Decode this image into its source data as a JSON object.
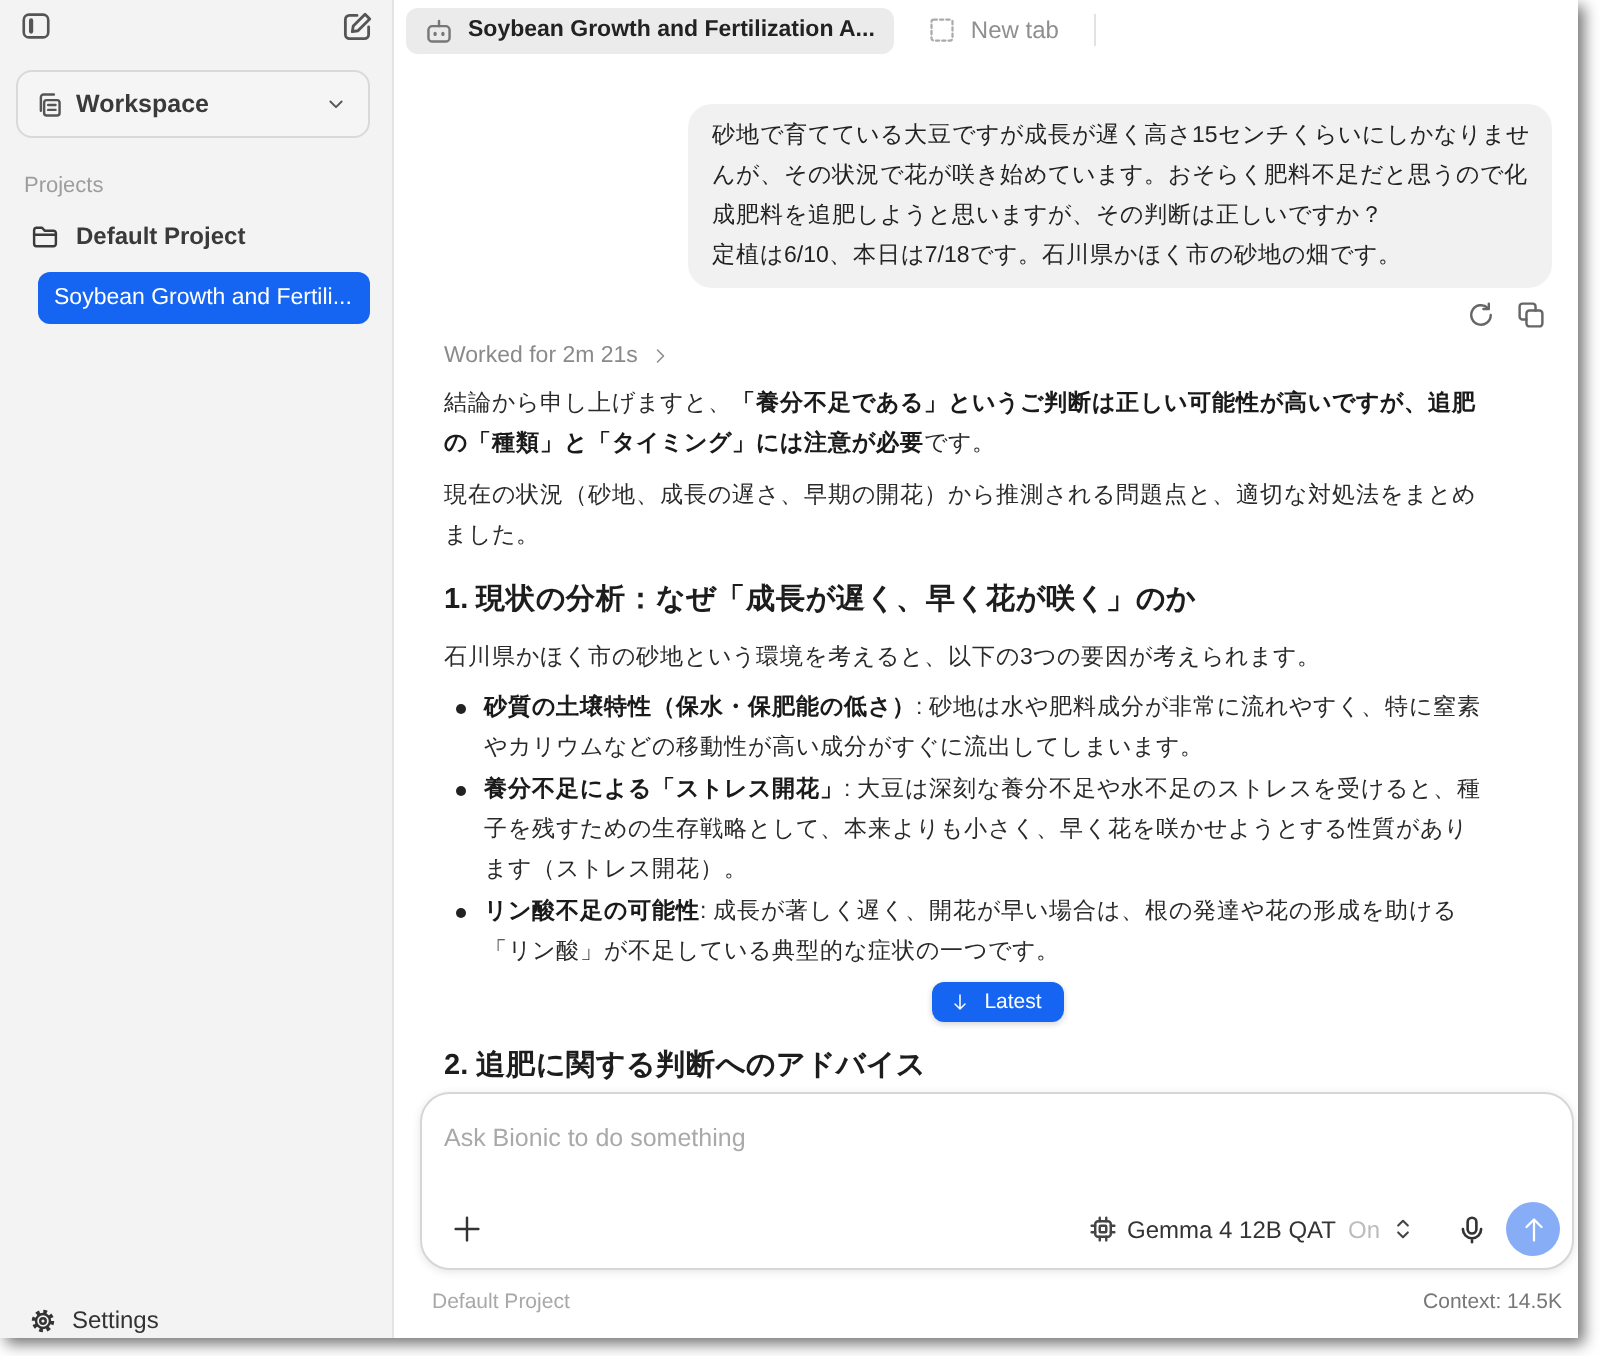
{
  "sidebar": {
    "workspace": {
      "label": "Workspace"
    },
    "projects_heading": "Projects",
    "projects": [
      {
        "label": "Default Project",
        "children": [
          {
            "label": "Soybean Growth and Fertili...",
            "selected": true
          }
        ]
      }
    ],
    "settings": {
      "label": "Settings"
    }
  },
  "tabs": [
    {
      "kind": "chat",
      "label": "Soybean Growth and Fertilization A...",
      "selected": true
    },
    {
      "kind": "new",
      "label": "New tab",
      "selected": false
    }
  ],
  "conversation": {
    "user_message": {
      "paragraphs": [
        "砂地で育てている大豆ですが成長が遅く高さ15センチくらいにしかなりませんが、その状況で花が咲き始めています。おそらく肥料不足だと思うので化成肥料を追肥しようと思いますが、その判断は正しいですか？",
        "定植は6/10、本日は7/18です。石川県かほく市の砂地の畑です。"
      ]
    },
    "assistant_message": {
      "worked": {
        "label": "Worked for 2m 21s",
        "expanded": false
      },
      "blocks": [
        {
          "kind": "paragraph",
          "text": "結論から申し上げますと、**「養分不足である」というご判断は正しい可能性が高いですが、追肥の「種類」と「タイミング」には注意が必要**です。"
        },
        {
          "kind": "paragraph",
          "text": "現在の状況（砂地、成長の遅さ、早期の開花）から推測される問題点と、適切な対処法をまとめました。"
        },
        {
          "kind": "heading",
          "text": "1. 現状の分析：なぜ「成長が遅く、早く花が咲く」のか"
        },
        {
          "kind": "paragraph",
          "text": "石川県かほく市の砂地という環境を考えると、以下の3つの要因が考えられます。"
        },
        {
          "kind": "list",
          "items": [
            "**砂質の土壌特性（保水・保肥能の低さ）**: 砂地は水や肥料成分が非常に流れやすく、特に窒素やカリウムなどの移動性が高い成分がすぐに流出してしまいます。",
            "**養分不足による「ストレス開花」**: 大豆は深刻な養分不足や水不足のストレスを受けると、種子を残すための生存戦略として、本来よりも小さく、早く花を咲かせようとする性質があります（ストレス開花）。",
            "**リン酸不足の可能性**: 成長が著しく遅く、開花が早い場合は、根の発達や花の形成を助ける「リン酸」が不足している典型的な症状の一つです。"
          ]
        },
        {
          "kind": "jump_button",
          "label": "Latest"
        },
        {
          "kind": "heading",
          "text": "2. 追肥に関する判断へのアドバイス"
        }
      ]
    }
  },
  "composer": {
    "placeholder": "Ask Bionic to do something",
    "model": {
      "name": "Gemma 4 12B QAT",
      "state_label": "On"
    },
    "send": {
      "disabled": true
    }
  },
  "footer": {
    "project": "Default Project",
    "context": "Context: 14.5K"
  }
}
